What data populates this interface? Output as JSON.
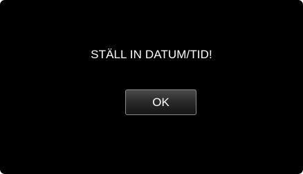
{
  "dialog": {
    "message": "STÄLL IN DATUM/TID!",
    "ok_label": "OK"
  },
  "colors": {
    "background": "#000000",
    "text": "#ffffff",
    "button_border": "#8a8a8a",
    "button_top": "#4a4a4a",
    "button_bottom": "#141414"
  }
}
